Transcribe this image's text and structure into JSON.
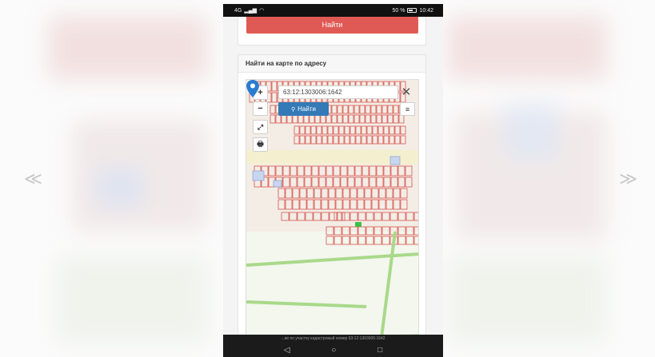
{
  "gallery": {
    "prev_arrow": "≪",
    "next_arrow": "≫"
  },
  "status_bar": {
    "left_text": "4G",
    "battery": "50 %",
    "time": "10:42"
  },
  "top_card": {
    "find_button_label": "Найти"
  },
  "map_card": {
    "header": "Найти на карте по адресу",
    "search_value": "63:12:1303006:1642",
    "search_button_label": "Найти",
    "zoom_in": "+",
    "zoom_out": "−",
    "close_glyph": "✕",
    "menu_glyph": "≡",
    "fullscreen_glyph": "⤢",
    "print_glyph": "🖶",
    "search_icon_glyph": "🔍"
  },
  "bottom": {
    "caption": "...ие по участку кадастровый номер 63:12:1303006:1642",
    "back_key": "◁",
    "home_key": "○",
    "recent_key": "□"
  },
  "colors": {
    "accent_red": "#e05a55",
    "accent_blue": "#337ab7",
    "parcel_red": "#d9534f",
    "road_green": "#a9d98a"
  }
}
